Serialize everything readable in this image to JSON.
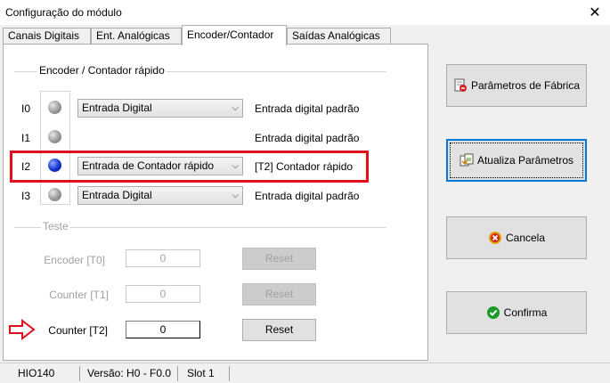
{
  "window": {
    "title": "Configuração do módulo",
    "close_glyph": "✕"
  },
  "tabs": [
    {
      "label": "Canais Digitais"
    },
    {
      "label": "Ent. Analógicas"
    },
    {
      "label": "Encoder/Contador",
      "active": true
    },
    {
      "label": "Saídas Analógicas"
    }
  ],
  "encoder_group": {
    "title": "Encoder / Contador rápido",
    "rows": [
      {
        "io": "I0",
        "led": "gray",
        "select": "Entrada Digital",
        "description": "Entrada digital padrão"
      },
      {
        "io": "I1",
        "led": "gray",
        "select": "",
        "description": "Entrada digital padrão"
      },
      {
        "io": "I2",
        "led": "blue",
        "select": "Entrada de Contador rápido",
        "description": "[T2] Contador rápido"
      },
      {
        "io": "I3",
        "led": "gray",
        "select": "Entrada Digital",
        "description": "Entrada digital padrão"
      }
    ],
    "chevron": "⌵"
  },
  "test_group": {
    "title": "Teste",
    "rows": [
      {
        "label": "Encoder [T0]",
        "value": "0",
        "button": "Reset",
        "enabled": false
      },
      {
        "label": "Counter [T1]",
        "value": "0",
        "button": "Reset",
        "enabled": false
      },
      {
        "label": "Counter [T2]",
        "value": "0",
        "button": "Reset",
        "enabled": true
      }
    ]
  },
  "side_buttons": {
    "factory": "Parâmetros de Fábrica",
    "update": "Atualiza Parâmetros",
    "cancel": "Cancela",
    "confirm": "Confirma"
  },
  "statusbar": {
    "model": "HIO140",
    "version": "Versão: H0 - F0.0",
    "slot": "Slot 1"
  },
  "colors": {
    "highlight": "#e0101a",
    "arrow": "#e0101a",
    "focus": "#0078d7"
  }
}
